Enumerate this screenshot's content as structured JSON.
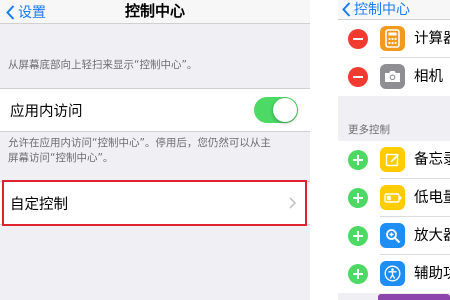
{
  "left": {
    "nav": {
      "back_label": "设置",
      "title": "控制中心"
    },
    "caption_top": "从屏幕底部向上轻扫来显示“控制中心”。",
    "in_app": {
      "label": "应用内访问",
      "toggle_on": true,
      "footer_line1": "允许在应用内访问“控制中心”。停用后，您仍然可以从主",
      "footer_line2": "屏幕访问“控制中心”。"
    },
    "customize": {
      "label": "自定控制"
    }
  },
  "right": {
    "nav": {
      "back_label": "控制中心"
    },
    "included": [
      {
        "label": "计算器",
        "icon": "calculator-icon",
        "color": "#f29a1e",
        "action": "remove"
      },
      {
        "label": "相机",
        "icon": "camera-icon",
        "color": "#8e8e93",
        "action": "remove"
      }
    ],
    "more_caption": "更多控制",
    "more": [
      {
        "label": "备忘录",
        "icon": "notes-icon",
        "color": "#ffcc00",
        "action": "add"
      },
      {
        "label": "低电量模式",
        "icon": "battery-icon",
        "color": "#ffcc00",
        "action": "add"
      },
      {
        "label": "放大器",
        "icon": "magnifier-icon",
        "color": "#1e8ef5",
        "action": "add"
      },
      {
        "label": "辅助功能快捷键",
        "icon": "accessibility-icon",
        "color": "#1e8ef5",
        "action": "add"
      }
    ]
  },
  "colors": {
    "accent": "#1b7bf5",
    "toggle_on": "#4cd964",
    "remove": "#f23b30",
    "add": "#4cd964",
    "highlight": "#e0242f"
  }
}
